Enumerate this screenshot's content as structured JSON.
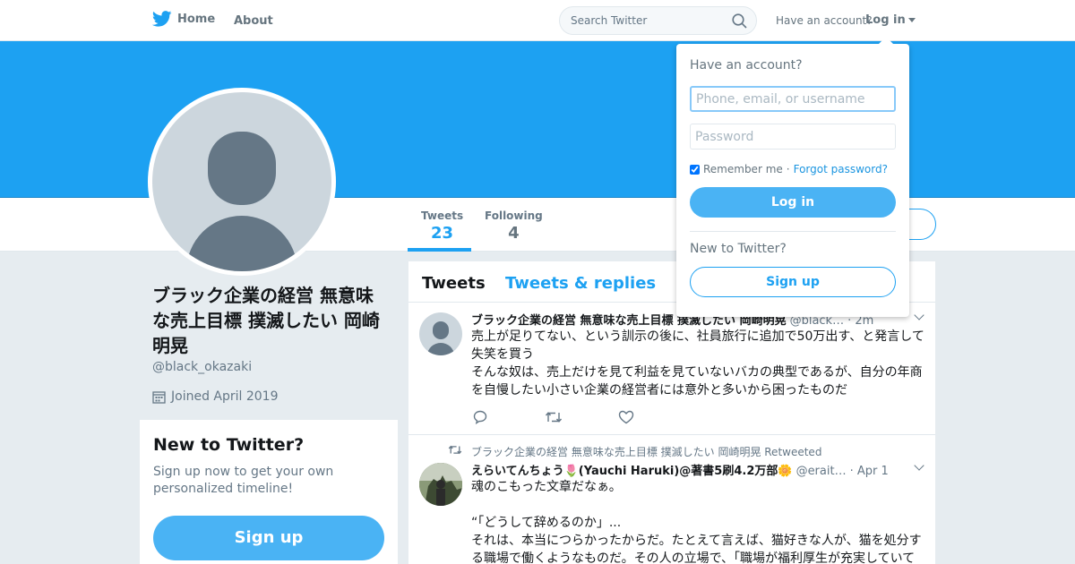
{
  "nav": {
    "home_label": "Home",
    "about_label": "About",
    "search_placeholder": "Search Twitter",
    "have_account": "Have an account?",
    "login_label": "Log in"
  },
  "colors": {
    "brand_blue": "#1da1f2",
    "button_blue": "#4ab3f4",
    "link_blue": "#1b95e0",
    "muted_text": "#657786"
  },
  "profile": {
    "name": "ブラック企業の経営 無意味な売上目標 撲滅したい 岡崎明晃",
    "handle": "@black_okazaki",
    "joined": "Joined April 2019",
    "stats": [
      {
        "label": "Tweets",
        "value": "23"
      },
      {
        "label": "Following",
        "value": "4"
      }
    ]
  },
  "new_to_twitter": {
    "title": "New to Twitter?",
    "text": "Sign up now to get your own personalized timeline!",
    "button": "Sign up"
  },
  "timeline": {
    "tabs": [
      "Tweets",
      "Tweets & replies"
    ],
    "tweets": [
      {
        "name": "ブラック企業の経営 無意味な売上目標 撲滅したい 岡崎明晃",
        "handle": "@black…",
        "time": "· 2m",
        "text": "売上が足りてない、という訓示の後に、社員旅行に追加で50万出す、と発言して失笑を買う\nそんな奴は、売上だけを見て利益を見ていないバカの典型であるが、自分の年商を自慢したい小さい企業の経営者には意外と多いから困ったものだ"
      },
      {
        "retweeted_by": "ブラック企業の経営 無意味な売上目標 撲滅したい 岡崎明晃 Retweeted",
        "name": "えらいてんちょう🌷(Yauchi Haruki)@著書5刷4.2万部🌼",
        "handle": "@erait…",
        "time": "· Apr 1",
        "text": "魂のこもった文章だなぁ。\n\n“「どうして辞めるのか」...\nそれは、本当につらかったからだ。たとえて言えば、猫好きな人が、猫を処分する職場で働くようなものだ。その人の立場で、「職場が福利厚生が充実していて"
      }
    ]
  },
  "login_dropdown": {
    "title": "Have an account?",
    "username_placeholder": "Phone, email, or username",
    "password_placeholder": "Password",
    "remember_me": "Remember me",
    "separator": "·",
    "forgot_password": "Forgot password?",
    "login_button": "Log in",
    "new_to_twitter": "New to Twitter?",
    "signup_button": "Sign up"
  }
}
